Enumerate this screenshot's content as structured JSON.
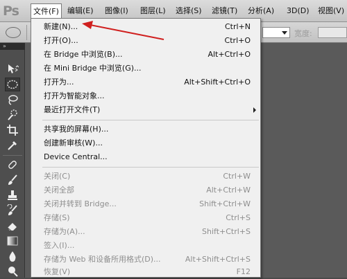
{
  "app": {
    "logo_text": "Ps"
  },
  "menubar": {
    "items": [
      {
        "label": "文件(F)",
        "active": true
      },
      {
        "label": "编辑(E)"
      },
      {
        "label": "图像(I)"
      },
      {
        "label": "图层(L)"
      },
      {
        "label": "选择(S)"
      },
      {
        "label": "滤镜(T)"
      },
      {
        "label": "分析(A)"
      },
      {
        "label": "3D(D)"
      },
      {
        "label": "视图(V)"
      }
    ]
  },
  "options_bar": {
    "width_label": "宽度:"
  },
  "file_menu": {
    "group1": [
      {
        "label": "新建(N)...",
        "shortcut": "Ctrl+N"
      },
      {
        "label": "打开(O)...",
        "shortcut": "Ctrl+O"
      },
      {
        "label": "在 Bridge 中浏览(B)...",
        "shortcut": "Alt+Ctrl+O"
      },
      {
        "label": "在 Mini Bridge 中浏览(G)...",
        "shortcut": ""
      },
      {
        "label": "打开为...",
        "shortcut": "Alt+Shift+Ctrl+O"
      },
      {
        "label": "打开为智能对象...",
        "shortcut": ""
      },
      {
        "label": "最近打开文件(T)",
        "shortcut": ""
      }
    ],
    "group2": [
      {
        "label": "共享我的屏幕(H)..."
      },
      {
        "label": "创建新审核(W)..."
      },
      {
        "label": "Device Central..."
      }
    ],
    "group3": [
      {
        "label": "关闭(C)",
        "shortcut": "Ctrl+W"
      },
      {
        "label": "关闭全部",
        "shortcut": "Alt+Ctrl+W"
      },
      {
        "label": "关闭并转到 Bridge...",
        "shortcut": "Shift+Ctrl+W"
      },
      {
        "label": "存储(S)",
        "shortcut": "Ctrl+S"
      },
      {
        "label": "存储为(A)...",
        "shortcut": "Shift+Ctrl+S"
      },
      {
        "label": "签入(I)...",
        "shortcut": ""
      },
      {
        "label": "存储为 Web 和设备所用格式(D)...",
        "shortcut": "Alt+Shift+Ctrl+S"
      },
      {
        "label": "恢复(V)",
        "shortcut": "F12"
      }
    ]
  },
  "colors": {
    "annotation_arrow": "#d0201f",
    "disabled_text": "#8e8e8e"
  },
  "icons": {
    "tools": [
      "move-icon",
      "elliptical-marquee-icon",
      "lasso-icon",
      "quick-selection-icon",
      "crop-icon",
      "eyedropper-icon",
      "spot-healing-icon",
      "brush-icon",
      "clone-stamp-icon",
      "history-brush-icon",
      "eraser-icon",
      "gradient-icon",
      "blur-icon",
      "dodge-icon"
    ]
  }
}
